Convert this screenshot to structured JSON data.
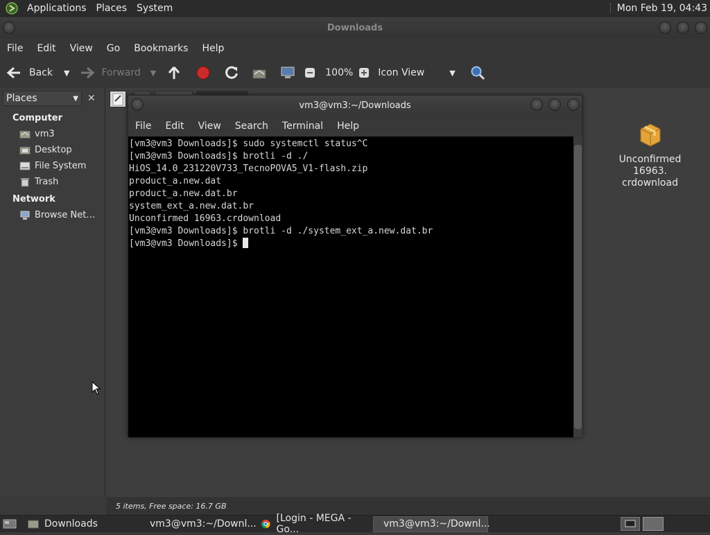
{
  "top_panel": {
    "menus": [
      "Applications",
      "Places",
      "System"
    ],
    "clock": "Mon Feb 19, 04:43"
  },
  "file_manager": {
    "title": "Downloads",
    "menu": [
      "File",
      "Edit",
      "View",
      "Go",
      "Bookmarks",
      "Help"
    ],
    "toolbar": {
      "back": "Back",
      "forward": "Forward",
      "zoom": "100%",
      "view_mode": "Icon View"
    },
    "sidebar": {
      "selector": "Places",
      "sections": [
        {
          "title": "Computer",
          "items": [
            {
              "label": "vm3",
              "icon": "home-folder-icon"
            },
            {
              "label": "Desktop",
              "icon": "desktop-folder-icon"
            },
            {
              "label": "File System",
              "icon": "drive-icon"
            },
            {
              "label": "Trash",
              "icon": "trash-icon"
            }
          ]
        },
        {
          "title": "Network",
          "items": [
            {
              "label": "Browse Net…",
              "icon": "network-icon"
            }
          ]
        }
      ]
    },
    "files": [
      {
        "name_line1": "Unconfirmed 16963.",
        "name_line2": "crdownload",
        "icon": "package-icon"
      }
    ],
    "status": "5 items, Free space: 16.7 GB"
  },
  "terminal": {
    "title": "vm3@vm3:~/Downloads",
    "menu": [
      "File",
      "Edit",
      "View",
      "Search",
      "Terminal",
      "Help"
    ],
    "lines": [
      "[vm3@vm3 Downloads]$ sudo systemctl status^C",
      "[vm3@vm3 Downloads]$ brotli -d ./",
      "HiOS_14.0_231220V733_TecnoPOVA5_V1-flash.zip",
      "product_a.new.dat",
      "product_a.new.dat.br",
      "system_ext_a.new.dat.br",
      "Unconfirmed 16963.crdownload",
      "[vm3@vm3 Downloads]$ brotli -d ./system_ext_a.new.dat.br"
    ],
    "prompt": "[vm3@vm3 Downloads]$ "
  },
  "taskbar": {
    "tasks": [
      {
        "label": "Downloads",
        "icon": "folder-icon",
        "active": false
      },
      {
        "label": "vm3@vm3:~/Downl...",
        "icon": "terminal-icon",
        "active": false
      },
      {
        "label": "[Login - MEGA - Go...",
        "icon": "chrome-icon",
        "active": false
      },
      {
        "label": "vm3@vm3:~/Downl...",
        "icon": "terminal-icon",
        "active": true
      }
    ]
  },
  "colors": {
    "panel_bg": "#2b2b2b",
    "window_bg": "#3e3e3e",
    "terminal_bg": "#000000",
    "terminal_fg": "#d8d8d8",
    "stop_red": "#cc2a2a"
  }
}
